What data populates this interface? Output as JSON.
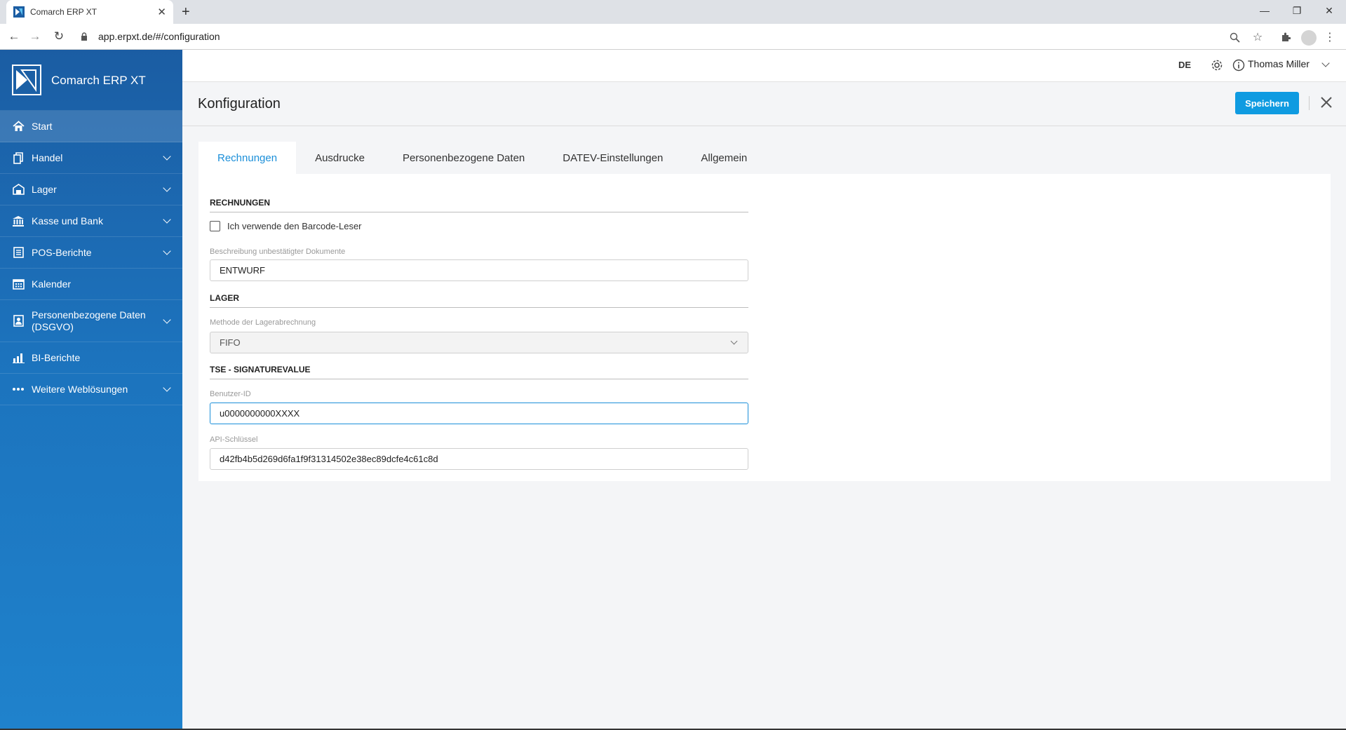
{
  "browser": {
    "tab_title": "Comarch ERP XT",
    "tab_close": "✕",
    "new_tab": "+",
    "url": "app.erpxt.de/#/configuration"
  },
  "sidebar": {
    "brand": "Comarch ERP XT",
    "items": [
      {
        "label": "Start",
        "icon": "home-icon"
      },
      {
        "label": "Handel",
        "icon": "documents-icon"
      },
      {
        "label": "Lager",
        "icon": "warehouse-icon"
      },
      {
        "label": "Kasse und Bank",
        "icon": "bank-icon"
      },
      {
        "label": "POS-Berichte",
        "icon": "report-icon"
      },
      {
        "label": "Kalender",
        "icon": "calendar-icon"
      },
      {
        "label": "Personenbezogene Daten (DSGVO)",
        "icon": "person-card-icon"
      },
      {
        "label": "BI-Berichte",
        "icon": "bar-chart-icon"
      },
      {
        "label": "Weitere Weblösungen",
        "icon": "more-dots-icon"
      }
    ]
  },
  "header": {
    "lang": "DE",
    "user": "Thomas Miller"
  },
  "page": {
    "title": "Konfiguration",
    "save_label": "Speichern"
  },
  "tabs": [
    "Rechnungen",
    "Ausdrucke",
    "Personenbezogene Daten",
    "DATEV-Einstellungen",
    "Allgemein"
  ],
  "form": {
    "rechnungen": {
      "heading": "RECHNUNGEN",
      "barcode_label": "Ich verwende den Barcode-Leser",
      "desc_label": "Beschreibung unbestätigter Dokumente",
      "desc_value": "ENTWURF"
    },
    "lager": {
      "heading": "LAGER",
      "method_label": "Methode der Lagerabrechnung",
      "method_value": "FIFO"
    },
    "tse": {
      "heading": "TSE - SIGNATUREVALUE",
      "user_label": "Benutzer-ID",
      "user_value": "u0000000000XXXX",
      "api_label": "API-Schlüssel",
      "api_value": "d42fb4b5d269d6fa1f9f31314502e38ec89dcfe4c61c8d"
    }
  },
  "colors": {
    "accent": "#1b8fd9",
    "button": "#0f9be1",
    "sidebar_top": "#1b5da3",
    "sidebar_bottom": "#1f82cc"
  }
}
